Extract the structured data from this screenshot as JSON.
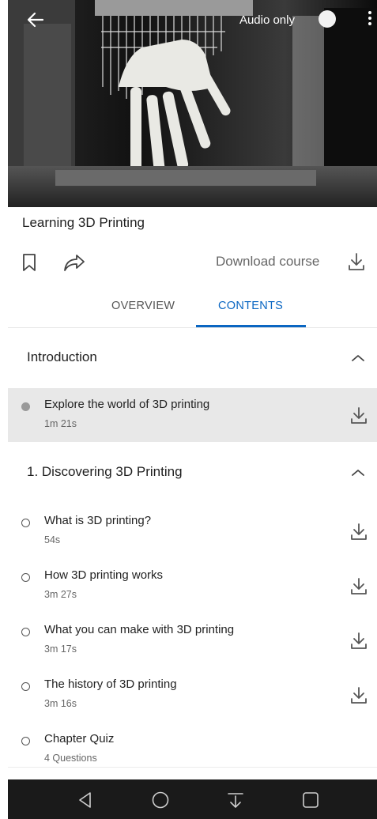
{
  "video": {
    "audio_only_label": "Audio only"
  },
  "course": {
    "title": "Learning 3D Printing",
    "download_label": "Download course"
  },
  "tabs": [
    {
      "label": "OVERVIEW",
      "active": false
    },
    {
      "label": "CONTENTS",
      "active": true
    }
  ],
  "colors": {
    "accent": "#0a66c2",
    "active_row_bg": "#e8e8e8"
  },
  "sections": [
    {
      "title": "Introduction",
      "items": [
        {
          "name": "Explore the world of 3D printing",
          "duration": "1m 21s",
          "state": "current"
        }
      ]
    },
    {
      "title": "1. Discovering 3D Printing",
      "items": [
        {
          "name": "What is 3D printing?",
          "duration": "54s"
        },
        {
          "name": "How 3D printing works",
          "duration": "3m 27s"
        },
        {
          "name": "What you can make with 3D printing",
          "duration": "3m 17s"
        },
        {
          "name": "The history of 3D printing",
          "duration": "3m 16s"
        },
        {
          "name": "Chapter Quiz",
          "duration": "4 Questions"
        }
      ]
    }
  ],
  "icons": [
    "back-arrow-icon",
    "more-vert-icon",
    "bookmark-icon",
    "share-icon",
    "download-icon",
    "chevron-up-icon",
    "nav-back-icon",
    "nav-home-icon",
    "nav-notification-icon",
    "nav-recents-icon"
  ]
}
